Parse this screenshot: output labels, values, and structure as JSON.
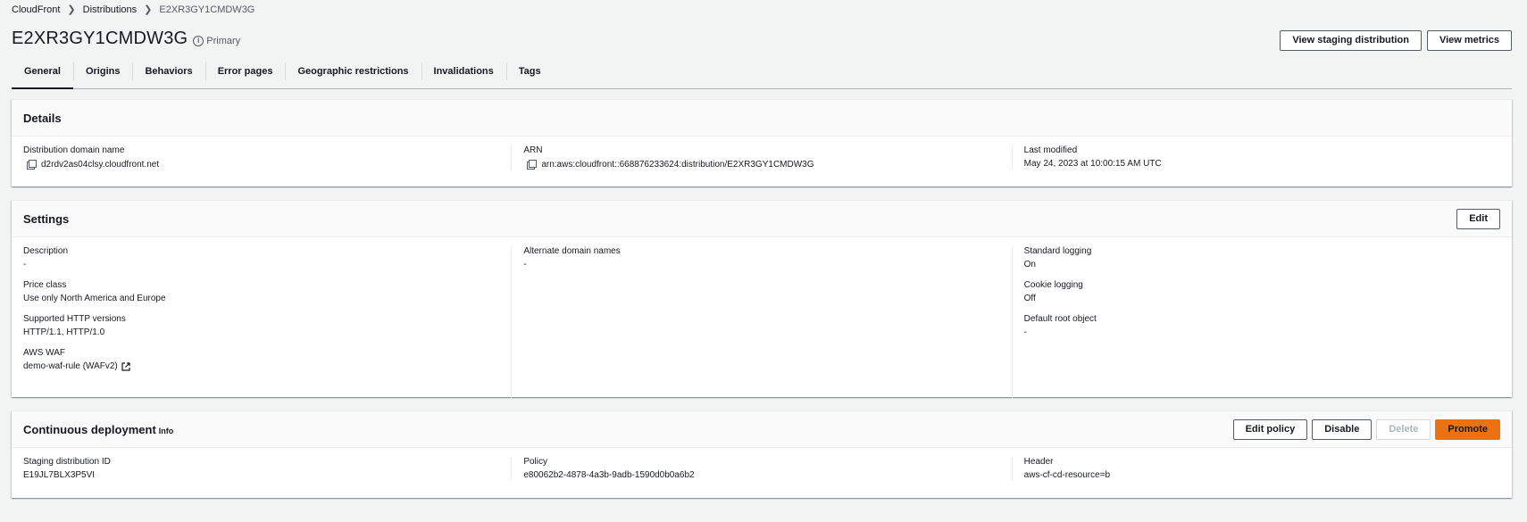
{
  "breadcrumb": {
    "root": "CloudFront",
    "section": "Distributions",
    "current": "E2XR3GY1CMDW3G"
  },
  "header": {
    "title": "E2XR3GY1CMDW3G",
    "badge": "Primary",
    "actions": {
      "view_staging": "View staging distribution",
      "view_metrics": "View metrics"
    }
  },
  "tabs": [
    {
      "label": "General",
      "active": true
    },
    {
      "label": "Origins"
    },
    {
      "label": "Behaviors"
    },
    {
      "label": "Error pages"
    },
    {
      "label": "Geographic restrictions"
    },
    {
      "label": "Invalidations"
    },
    {
      "label": "Tags"
    }
  ],
  "details": {
    "title": "Details",
    "domain_label": "Distribution domain name",
    "domain_value": "d2rdv2as04clsy.cloudfront.net",
    "arn_label": "ARN",
    "arn_value": "arn:aws:cloudfront::668876233624:distribution/E2XR3GY1CMDW3G",
    "modified_label": "Last modified",
    "modified_value": "May 24, 2023 at 10:00:15 AM UTC"
  },
  "settings": {
    "title": "Settings",
    "edit_label": "Edit",
    "description_label": "Description",
    "description_value": "-",
    "price_class_label": "Price class",
    "price_class_value": "Use only North America and Europe",
    "http_versions_label": "Supported HTTP versions",
    "http_versions_value": "HTTP/1.1, HTTP/1.0",
    "waf_label": "AWS WAF",
    "waf_value": "demo-waf-rule (WAFv2)",
    "alt_domains_label": "Alternate domain names",
    "alt_domains_value": "-",
    "std_logging_label": "Standard logging",
    "std_logging_value": "On",
    "cookie_logging_label": "Cookie logging",
    "cookie_logging_value": "Off",
    "root_object_label": "Default root object",
    "root_object_value": "-"
  },
  "continuous": {
    "title": "Continuous deployment",
    "info": "Info",
    "edit_policy": "Edit policy",
    "disable": "Disable",
    "delete": "Delete",
    "promote": "Promote",
    "staging_id_label": "Staging distribution ID",
    "staging_id_value": "E19JL7BLX3P5VI",
    "policy_label": "Policy",
    "policy_value": "e80062b2-4878-4a3b-9adb-1590d0b0a6b2",
    "header_label": "Header",
    "header_value": "aws-cf-cd-resource=b"
  },
  "colors": {
    "accent": "#ec7211",
    "background": "#f2f3f3"
  }
}
